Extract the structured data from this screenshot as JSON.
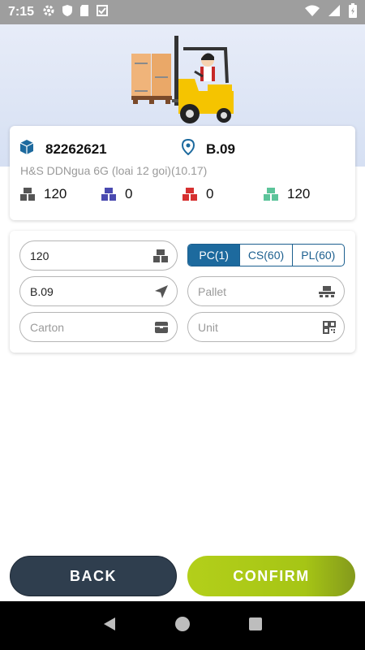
{
  "status_bar": {
    "time": "7:15",
    "icons": [
      "gear-icon",
      "shield-icon",
      "sd-card-icon",
      "signal-check-icon",
      "wifi-icon",
      "cell-signal-icon",
      "battery-icon"
    ]
  },
  "product": {
    "code": "82262621",
    "location": "B.09",
    "description": "H&S DDNgua 6G (loai 12 goi)(10.17)",
    "quantities": [
      {
        "name": "total",
        "value": "120",
        "color": "#555555"
      },
      {
        "name": "blue",
        "value": "0",
        "color": "#4a4ab0"
      },
      {
        "name": "red",
        "value": "0",
        "color": "#d63030"
      },
      {
        "name": "green",
        "value": "120",
        "color": "#5cc49a"
      }
    ]
  },
  "form": {
    "quantity_value": "120",
    "units": [
      {
        "label": "PC(1)",
        "active": true
      },
      {
        "label": "CS(60)",
        "active": false
      },
      {
        "label": "PL(60)",
        "active": false
      }
    ],
    "location_value": "B.09",
    "pallet_placeholder": "Pallet",
    "carton_placeholder": "Carton",
    "unit_placeholder": "Unit"
  },
  "actions": {
    "back_label": "BACK",
    "confirm_label": "CONFIRM"
  },
  "colors": {
    "accent": "#1d6a9e",
    "back_button": "#2f3e4e",
    "confirm_button": "#a6c515",
    "status_bar": "#9e9e9e"
  }
}
